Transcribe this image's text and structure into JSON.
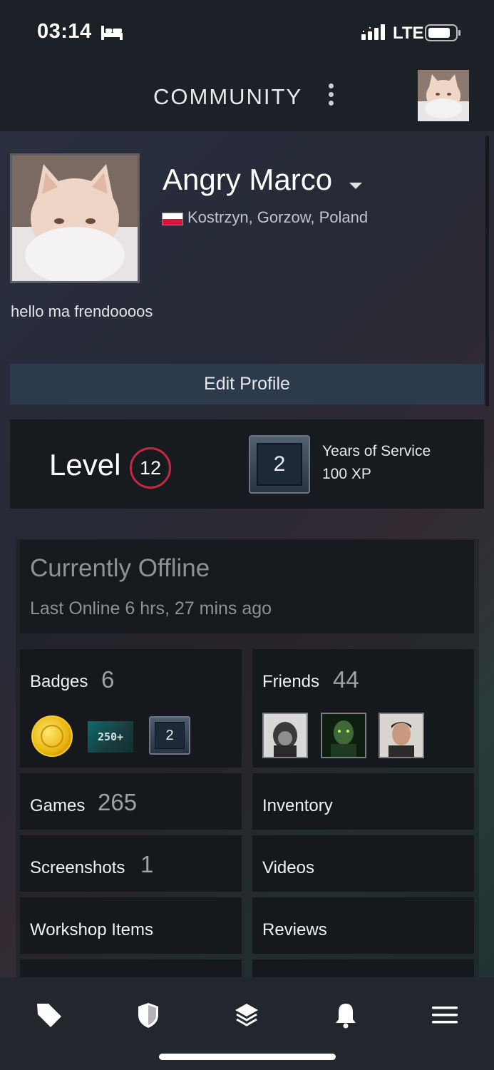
{
  "status_bar": {
    "time": "03:14",
    "network": "LTE"
  },
  "header": {
    "title": "COMMUNITY"
  },
  "profile": {
    "name": "Angry Marco",
    "location": "Kostrzyn, Gorzow, Poland",
    "summary": "hello ma frendoooos",
    "edit_button": "Edit Profile"
  },
  "level": {
    "label": "Level",
    "value": "12",
    "badge_value": "2",
    "badge_title": "Years of Service",
    "badge_xp": "100 XP"
  },
  "online_status": {
    "title": "Currently Offline",
    "last_online": "Last Online 6 hrs, 27 mins ago"
  },
  "tiles": {
    "badges": {
      "label": "Badges",
      "count": "6",
      "items": [
        "gold-coin-badge",
        "250+",
        "2"
      ]
    },
    "friends": {
      "label": "Friends",
      "count": "44"
    },
    "games": {
      "label": "Games",
      "count": "265"
    },
    "inventory": {
      "label": "Inventory"
    },
    "screenshots": {
      "label": "Screenshots",
      "count": "1"
    },
    "videos": {
      "label": "Videos"
    },
    "workshop": {
      "label": "Workshop Items"
    },
    "reviews": {
      "label": "Reviews"
    }
  },
  "tabbar": {
    "items": [
      "tag-icon",
      "shield-icon",
      "layers-icon",
      "bell-icon",
      "menu-icon"
    ]
  },
  "colors": {
    "level_ring": "#c4283f",
    "edit_button_bg": "#2c3a4c",
    "tile_bg": "#15181c"
  }
}
